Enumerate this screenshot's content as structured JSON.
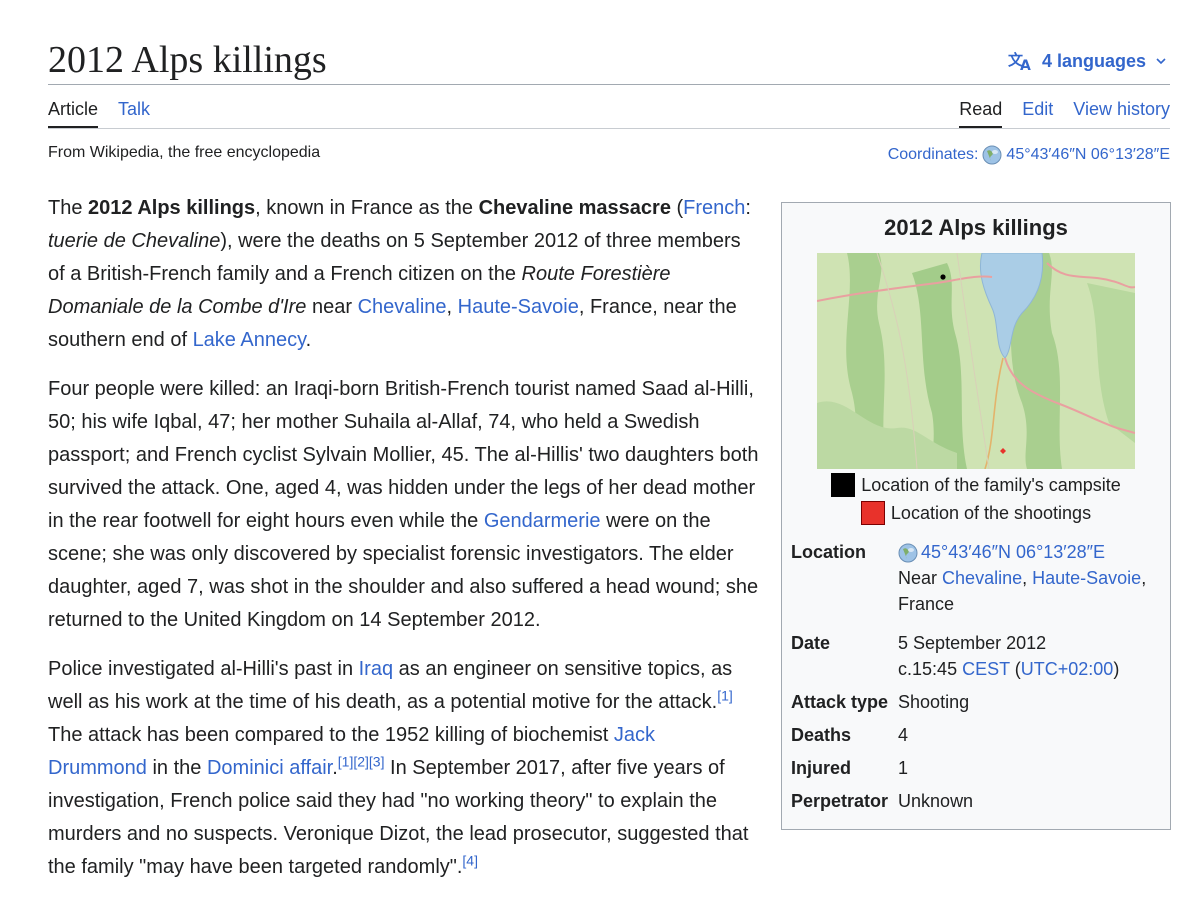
{
  "page": {
    "title": "2012 Alps killings",
    "languages_label": "4 languages",
    "tabs_left": [
      "Article",
      "Talk"
    ],
    "tabs_right": [
      "Read",
      "Edit",
      "View history"
    ],
    "tagline": "From Wikipedia, the free encyclopedia",
    "coordinates_label": "Coordinates:",
    "coordinates_value": "45°43′46″N 06°13′28″E"
  },
  "colors": {
    "link": "#3366cc",
    "text": "#202122",
    "infobox_bg": "#f8f9fa",
    "border": "#a2a9b1"
  },
  "icons": {
    "language": "translate-icon",
    "dropdown": "chevron-down-icon",
    "coordinates": "globe-icon"
  },
  "article": {
    "p1": {
      "t1": "The ",
      "b1": "2012 Alps killings",
      "t2": ", known in France as the ",
      "b2": "Chevaline massacre",
      "t3": " (",
      "l_french": "French",
      "t4": ": ",
      "i1": "tuerie de Chevaline",
      "t5": "), were the deaths on 5 September 2012 of three members of a British-French family and a French citizen on the ",
      "i2": "Route Forestière Domaniale de la Combe d'Ire",
      "t6": " near ",
      "l_chevaline": "Chevaline",
      "t7": ", ",
      "l_hautesavoie": "Haute-Savoie",
      "t8": ", France, near the southern end of ",
      "l_lake": "Lake Annecy",
      "t9": "."
    },
    "p2": {
      "t1": "Four people were killed: an Iraqi-born British-French tourist named Saad al-Hilli, 50; his wife Iqbal, 47; her mother Suhaila al-Allaf, 74, who held a Swedish passport; and French cyclist Sylvain Mollier, 45. The al-Hillis' two daughters both survived the attack. One, aged 4, was hidden under the legs of her dead mother in the rear footwell for eight hours even while the ",
      "l_gendarmerie": "Gendarmerie",
      "t2": " were on the scene; she was only discovered by specialist forensic investigators. The elder daughter, aged 7, was shot in the shoulder and also suffered a head wound; she returned to the United Kingdom on 14 September 2012."
    },
    "p3": {
      "t1": "Police investigated al-Hilli's past in ",
      "l_iraq": "Iraq",
      "t2": " as an engineer on sensitive topics, as well as his work at the time of his death, as a potential motive for the attack.",
      "r1": "[1]",
      "t3": " The attack has been compared to the 1952 killing of biochemist ",
      "l_jack": "Jack Drummond",
      "t4": " in the ",
      "l_dominici": "Dominici affair",
      "t5": ".",
      "r2": "[1]",
      "r3": "[2]",
      "r4": "[3]",
      "t6": " In September 2017, after five years of investigation, French police said they had \"no working theory\" to explain the murders and no suspects. Veronique Dizot, the lead prosecutor, suggested that the family \"may have been targeted randomly\".",
      "r5": "[4]"
    }
  },
  "infobox": {
    "title": "2012 Alps killings",
    "legend_black": "Location of the family's campsite",
    "legend_red": "Location of the shootings",
    "rows": {
      "location": {
        "label": "Location",
        "coords": "45°43′46″N 06°13′28″E",
        "near": "Near ",
        "l_chevaline": "Chevaline",
        "sep": ", ",
        "l_hautesavoie": "Haute-Savoie",
        "comma": ",",
        "country": "France"
      },
      "date": {
        "label": "Date",
        "line1": "5 September 2012",
        "line2_pre": "c.15:45 ",
        "l_cest": "CEST",
        "paren_open": " (",
        "l_utc": "UTC+02:00",
        "paren_close": ")"
      },
      "attack_type": {
        "label": "Attack type",
        "value": "Shooting"
      },
      "deaths": {
        "label": "Deaths",
        "value": "4"
      },
      "injured": {
        "label": "Injured",
        "value": "1"
      },
      "perpetrator": {
        "label": "Perpetrator",
        "value": "Unknown"
      }
    }
  }
}
